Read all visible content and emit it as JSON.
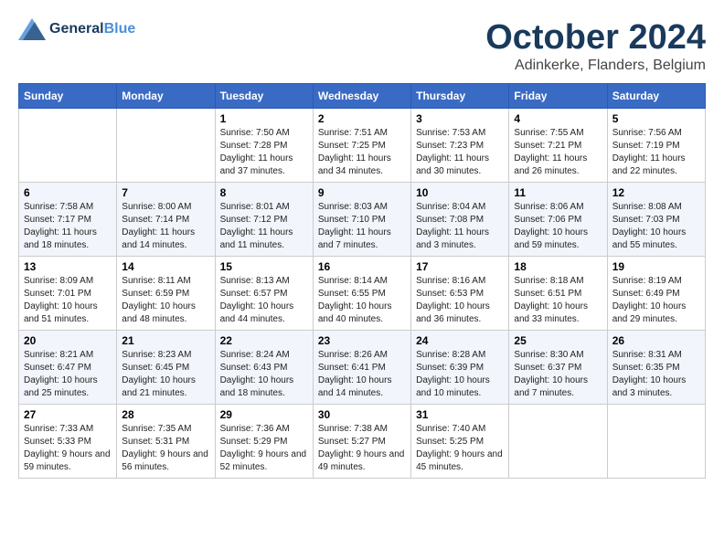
{
  "header": {
    "logo_line1": "General",
    "logo_line2": "Blue",
    "month": "October 2024",
    "location": "Adinkerke, Flanders, Belgium"
  },
  "days_of_week": [
    "Sunday",
    "Monday",
    "Tuesday",
    "Wednesday",
    "Thursday",
    "Friday",
    "Saturday"
  ],
  "weeks": [
    [
      {
        "day": "",
        "sunrise": "",
        "sunset": "",
        "daylight": ""
      },
      {
        "day": "",
        "sunrise": "",
        "sunset": "",
        "daylight": ""
      },
      {
        "day": "1",
        "sunrise": "Sunrise: 7:50 AM",
        "sunset": "Sunset: 7:28 PM",
        "daylight": "Daylight: 11 hours and 37 minutes."
      },
      {
        "day": "2",
        "sunrise": "Sunrise: 7:51 AM",
        "sunset": "Sunset: 7:25 PM",
        "daylight": "Daylight: 11 hours and 34 minutes."
      },
      {
        "day": "3",
        "sunrise": "Sunrise: 7:53 AM",
        "sunset": "Sunset: 7:23 PM",
        "daylight": "Daylight: 11 hours and 30 minutes."
      },
      {
        "day": "4",
        "sunrise": "Sunrise: 7:55 AM",
        "sunset": "Sunset: 7:21 PM",
        "daylight": "Daylight: 11 hours and 26 minutes."
      },
      {
        "day": "5",
        "sunrise": "Sunrise: 7:56 AM",
        "sunset": "Sunset: 7:19 PM",
        "daylight": "Daylight: 11 hours and 22 minutes."
      }
    ],
    [
      {
        "day": "6",
        "sunrise": "Sunrise: 7:58 AM",
        "sunset": "Sunset: 7:17 PM",
        "daylight": "Daylight: 11 hours and 18 minutes."
      },
      {
        "day": "7",
        "sunrise": "Sunrise: 8:00 AM",
        "sunset": "Sunset: 7:14 PM",
        "daylight": "Daylight: 11 hours and 14 minutes."
      },
      {
        "day": "8",
        "sunrise": "Sunrise: 8:01 AM",
        "sunset": "Sunset: 7:12 PM",
        "daylight": "Daylight: 11 hours and 11 minutes."
      },
      {
        "day": "9",
        "sunrise": "Sunrise: 8:03 AM",
        "sunset": "Sunset: 7:10 PM",
        "daylight": "Daylight: 11 hours and 7 minutes."
      },
      {
        "day": "10",
        "sunrise": "Sunrise: 8:04 AM",
        "sunset": "Sunset: 7:08 PM",
        "daylight": "Daylight: 11 hours and 3 minutes."
      },
      {
        "day": "11",
        "sunrise": "Sunrise: 8:06 AM",
        "sunset": "Sunset: 7:06 PM",
        "daylight": "Daylight: 10 hours and 59 minutes."
      },
      {
        "day": "12",
        "sunrise": "Sunrise: 8:08 AM",
        "sunset": "Sunset: 7:03 PM",
        "daylight": "Daylight: 10 hours and 55 minutes."
      }
    ],
    [
      {
        "day": "13",
        "sunrise": "Sunrise: 8:09 AM",
        "sunset": "Sunset: 7:01 PM",
        "daylight": "Daylight: 10 hours and 51 minutes."
      },
      {
        "day": "14",
        "sunrise": "Sunrise: 8:11 AM",
        "sunset": "Sunset: 6:59 PM",
        "daylight": "Daylight: 10 hours and 48 minutes."
      },
      {
        "day": "15",
        "sunrise": "Sunrise: 8:13 AM",
        "sunset": "Sunset: 6:57 PM",
        "daylight": "Daylight: 10 hours and 44 minutes."
      },
      {
        "day": "16",
        "sunrise": "Sunrise: 8:14 AM",
        "sunset": "Sunset: 6:55 PM",
        "daylight": "Daylight: 10 hours and 40 minutes."
      },
      {
        "day": "17",
        "sunrise": "Sunrise: 8:16 AM",
        "sunset": "Sunset: 6:53 PM",
        "daylight": "Daylight: 10 hours and 36 minutes."
      },
      {
        "day": "18",
        "sunrise": "Sunrise: 8:18 AM",
        "sunset": "Sunset: 6:51 PM",
        "daylight": "Daylight: 10 hours and 33 minutes."
      },
      {
        "day": "19",
        "sunrise": "Sunrise: 8:19 AM",
        "sunset": "Sunset: 6:49 PM",
        "daylight": "Daylight: 10 hours and 29 minutes."
      }
    ],
    [
      {
        "day": "20",
        "sunrise": "Sunrise: 8:21 AM",
        "sunset": "Sunset: 6:47 PM",
        "daylight": "Daylight: 10 hours and 25 minutes."
      },
      {
        "day": "21",
        "sunrise": "Sunrise: 8:23 AM",
        "sunset": "Sunset: 6:45 PM",
        "daylight": "Daylight: 10 hours and 21 minutes."
      },
      {
        "day": "22",
        "sunrise": "Sunrise: 8:24 AM",
        "sunset": "Sunset: 6:43 PM",
        "daylight": "Daylight: 10 hours and 18 minutes."
      },
      {
        "day": "23",
        "sunrise": "Sunrise: 8:26 AM",
        "sunset": "Sunset: 6:41 PM",
        "daylight": "Daylight: 10 hours and 14 minutes."
      },
      {
        "day": "24",
        "sunrise": "Sunrise: 8:28 AM",
        "sunset": "Sunset: 6:39 PM",
        "daylight": "Daylight: 10 hours and 10 minutes."
      },
      {
        "day": "25",
        "sunrise": "Sunrise: 8:30 AM",
        "sunset": "Sunset: 6:37 PM",
        "daylight": "Daylight: 10 hours and 7 minutes."
      },
      {
        "day": "26",
        "sunrise": "Sunrise: 8:31 AM",
        "sunset": "Sunset: 6:35 PM",
        "daylight": "Daylight: 10 hours and 3 minutes."
      }
    ],
    [
      {
        "day": "27",
        "sunrise": "Sunrise: 7:33 AM",
        "sunset": "Sunset: 5:33 PM",
        "daylight": "Daylight: 9 hours and 59 minutes."
      },
      {
        "day": "28",
        "sunrise": "Sunrise: 7:35 AM",
        "sunset": "Sunset: 5:31 PM",
        "daylight": "Daylight: 9 hours and 56 minutes."
      },
      {
        "day": "29",
        "sunrise": "Sunrise: 7:36 AM",
        "sunset": "Sunset: 5:29 PM",
        "daylight": "Daylight: 9 hours and 52 minutes."
      },
      {
        "day": "30",
        "sunrise": "Sunrise: 7:38 AM",
        "sunset": "Sunset: 5:27 PM",
        "daylight": "Daylight: 9 hours and 49 minutes."
      },
      {
        "day": "31",
        "sunrise": "Sunrise: 7:40 AM",
        "sunset": "Sunset: 5:25 PM",
        "daylight": "Daylight: 9 hours and 45 minutes."
      },
      {
        "day": "",
        "sunrise": "",
        "sunset": "",
        "daylight": ""
      },
      {
        "day": "",
        "sunrise": "",
        "sunset": "",
        "daylight": ""
      }
    ]
  ]
}
